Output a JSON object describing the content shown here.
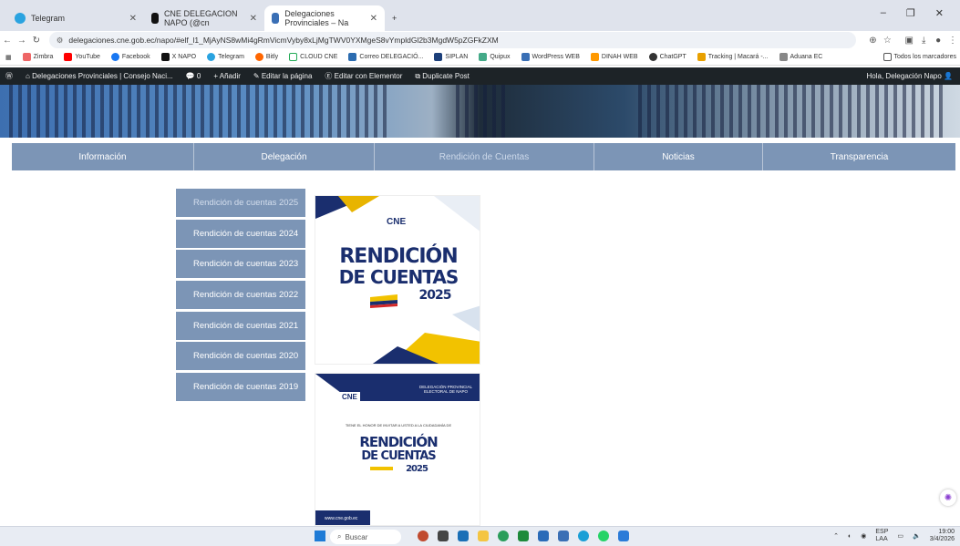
{
  "browser": {
    "tabs": [
      {
        "label": "Telegram",
        "color": "#2aa3e0"
      },
      {
        "label": "CNE DELEGACION NAPO (@cn",
        "color": "#111111"
      },
      {
        "label": "Delegaciones Provinciales – Na",
        "color": "#3a6fb5"
      }
    ],
    "new_tab": "+",
    "url": "delegaciones.cne.gob.ec/napo/#elf_l1_MjAyNS8wMi4gRmVicmVyby8xLjMgTWV0YXMgeS8vYmpldGl2b3MgdW5pZGFkZXM",
    "bookmarks": [
      "Zimbra",
      "YouTube",
      "Facebook",
      "X NAPO",
      "Telegram",
      "Bitly",
      "CLOUD CNE",
      "Correo DELEGACIÓ...",
      "SIPLAN",
      "Quipux",
      "WordPress WEB",
      "DINAH WEB",
      "ChatGPT",
      "Tracking | Macará -...",
      "Aduana EC"
    ],
    "all_bookmarks": "Todos los marcadores"
  },
  "wp_admin": {
    "site": "Delegaciones Provinciales | Consejo Naci...",
    "comments": "0",
    "add": "Añadir",
    "edit_page": "Editar la página",
    "elementor": "Editar con Elementor",
    "duplicate": "Duplicate Post",
    "greeting": "Hola, Delegación Napo"
  },
  "menu": [
    {
      "label": "Información",
      "width": 200
    },
    {
      "label": "Delegación",
      "width": 198
    },
    {
      "label": "Rendición de Cuentas",
      "width": 241
    },
    {
      "label": "Noticias",
      "width": 185
    },
    {
      "label": "Transparencia",
      "width": 211
    }
  ],
  "sidebar": {
    "items": [
      "Rendición de cuentas 2025",
      "Rendición de cuentas 2024",
      "Rendición de cuentas 2023",
      "Rendición de cuentas 2022",
      "Rendición de cuentas 2021",
      "Rendición de cuentas 2020",
      "Rendición de cuentas 2019"
    ]
  },
  "poster1": {
    "logo": "CNE",
    "line1": "RENDICIÓN",
    "line2": "DE CUENTAS",
    "year": "2025"
  },
  "poster2": {
    "logo": "CNE",
    "header": "DELEGACIÓN PROVINCIAL ELECTORAL DE NAPO",
    "intro": "TIENE EL HONOR DE INVITAR A USTED A LA CIUDADANÍA DE",
    "line1": "RENDICIÓN",
    "line2": "DE CUENTAS",
    "year": "2025",
    "footer": "www.cne.gob.ec"
  },
  "taskbar": {
    "search": "Buscar",
    "lang": "ESP",
    "lang2": "LAA",
    "time": "19:00",
    "date": "3/4/2026"
  }
}
